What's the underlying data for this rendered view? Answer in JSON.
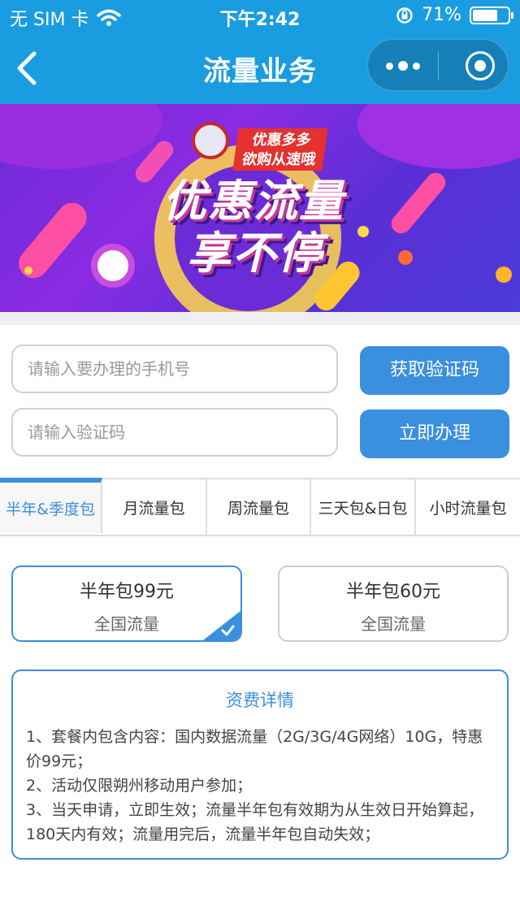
{
  "status_bar": {
    "carrier": "无 SIM 卡",
    "time": "下午2:42",
    "battery": "71%",
    "battery_level": 0.71
  },
  "nav": {
    "title": "流量业务",
    "back_icon": "chevron-left-icon",
    "more_icon": "more-dots-icon",
    "close_icon": "target-close-icon"
  },
  "banner": {
    "tag_line1": "优惠多多",
    "tag_line2": "欲购从速哦",
    "headline_line1": "优惠流量",
    "headline_line2": "享不停"
  },
  "form": {
    "phone_placeholder": "请输入要办理的手机号",
    "code_placeholder": "请输入验证码",
    "get_code_label": "获取验证码",
    "submit_label": "立即办理"
  },
  "tabs": [
    {
      "label": "半年&季度包",
      "active": true
    },
    {
      "label": "月流量包",
      "active": false
    },
    {
      "label": "周流量包",
      "active": false
    },
    {
      "label": "三天包&日包",
      "active": false
    },
    {
      "label": "小时流量包",
      "active": false
    }
  ],
  "packages": [
    {
      "name": "半年包99元",
      "type": "全国流量",
      "selected": true
    },
    {
      "name": "半年包60元",
      "type": "全国流量",
      "selected": false
    }
  ],
  "details": {
    "title": "资费详情",
    "lines": [
      "1、套餐内包含内容：国内数据流量（2G/3G/4G网络）10G，特惠价99元；",
      "2、活动仅限朔州移动用户参加；",
      "3、当天申请，立即生效；流量半年包有效期为从生效日开始算起，180天内有效；流量用完后，流量半年包自动失效；"
    ]
  },
  "colors": {
    "header": "#1a9de0",
    "accent": "#3a8fdf",
    "tag_red": "#e5312f"
  }
}
